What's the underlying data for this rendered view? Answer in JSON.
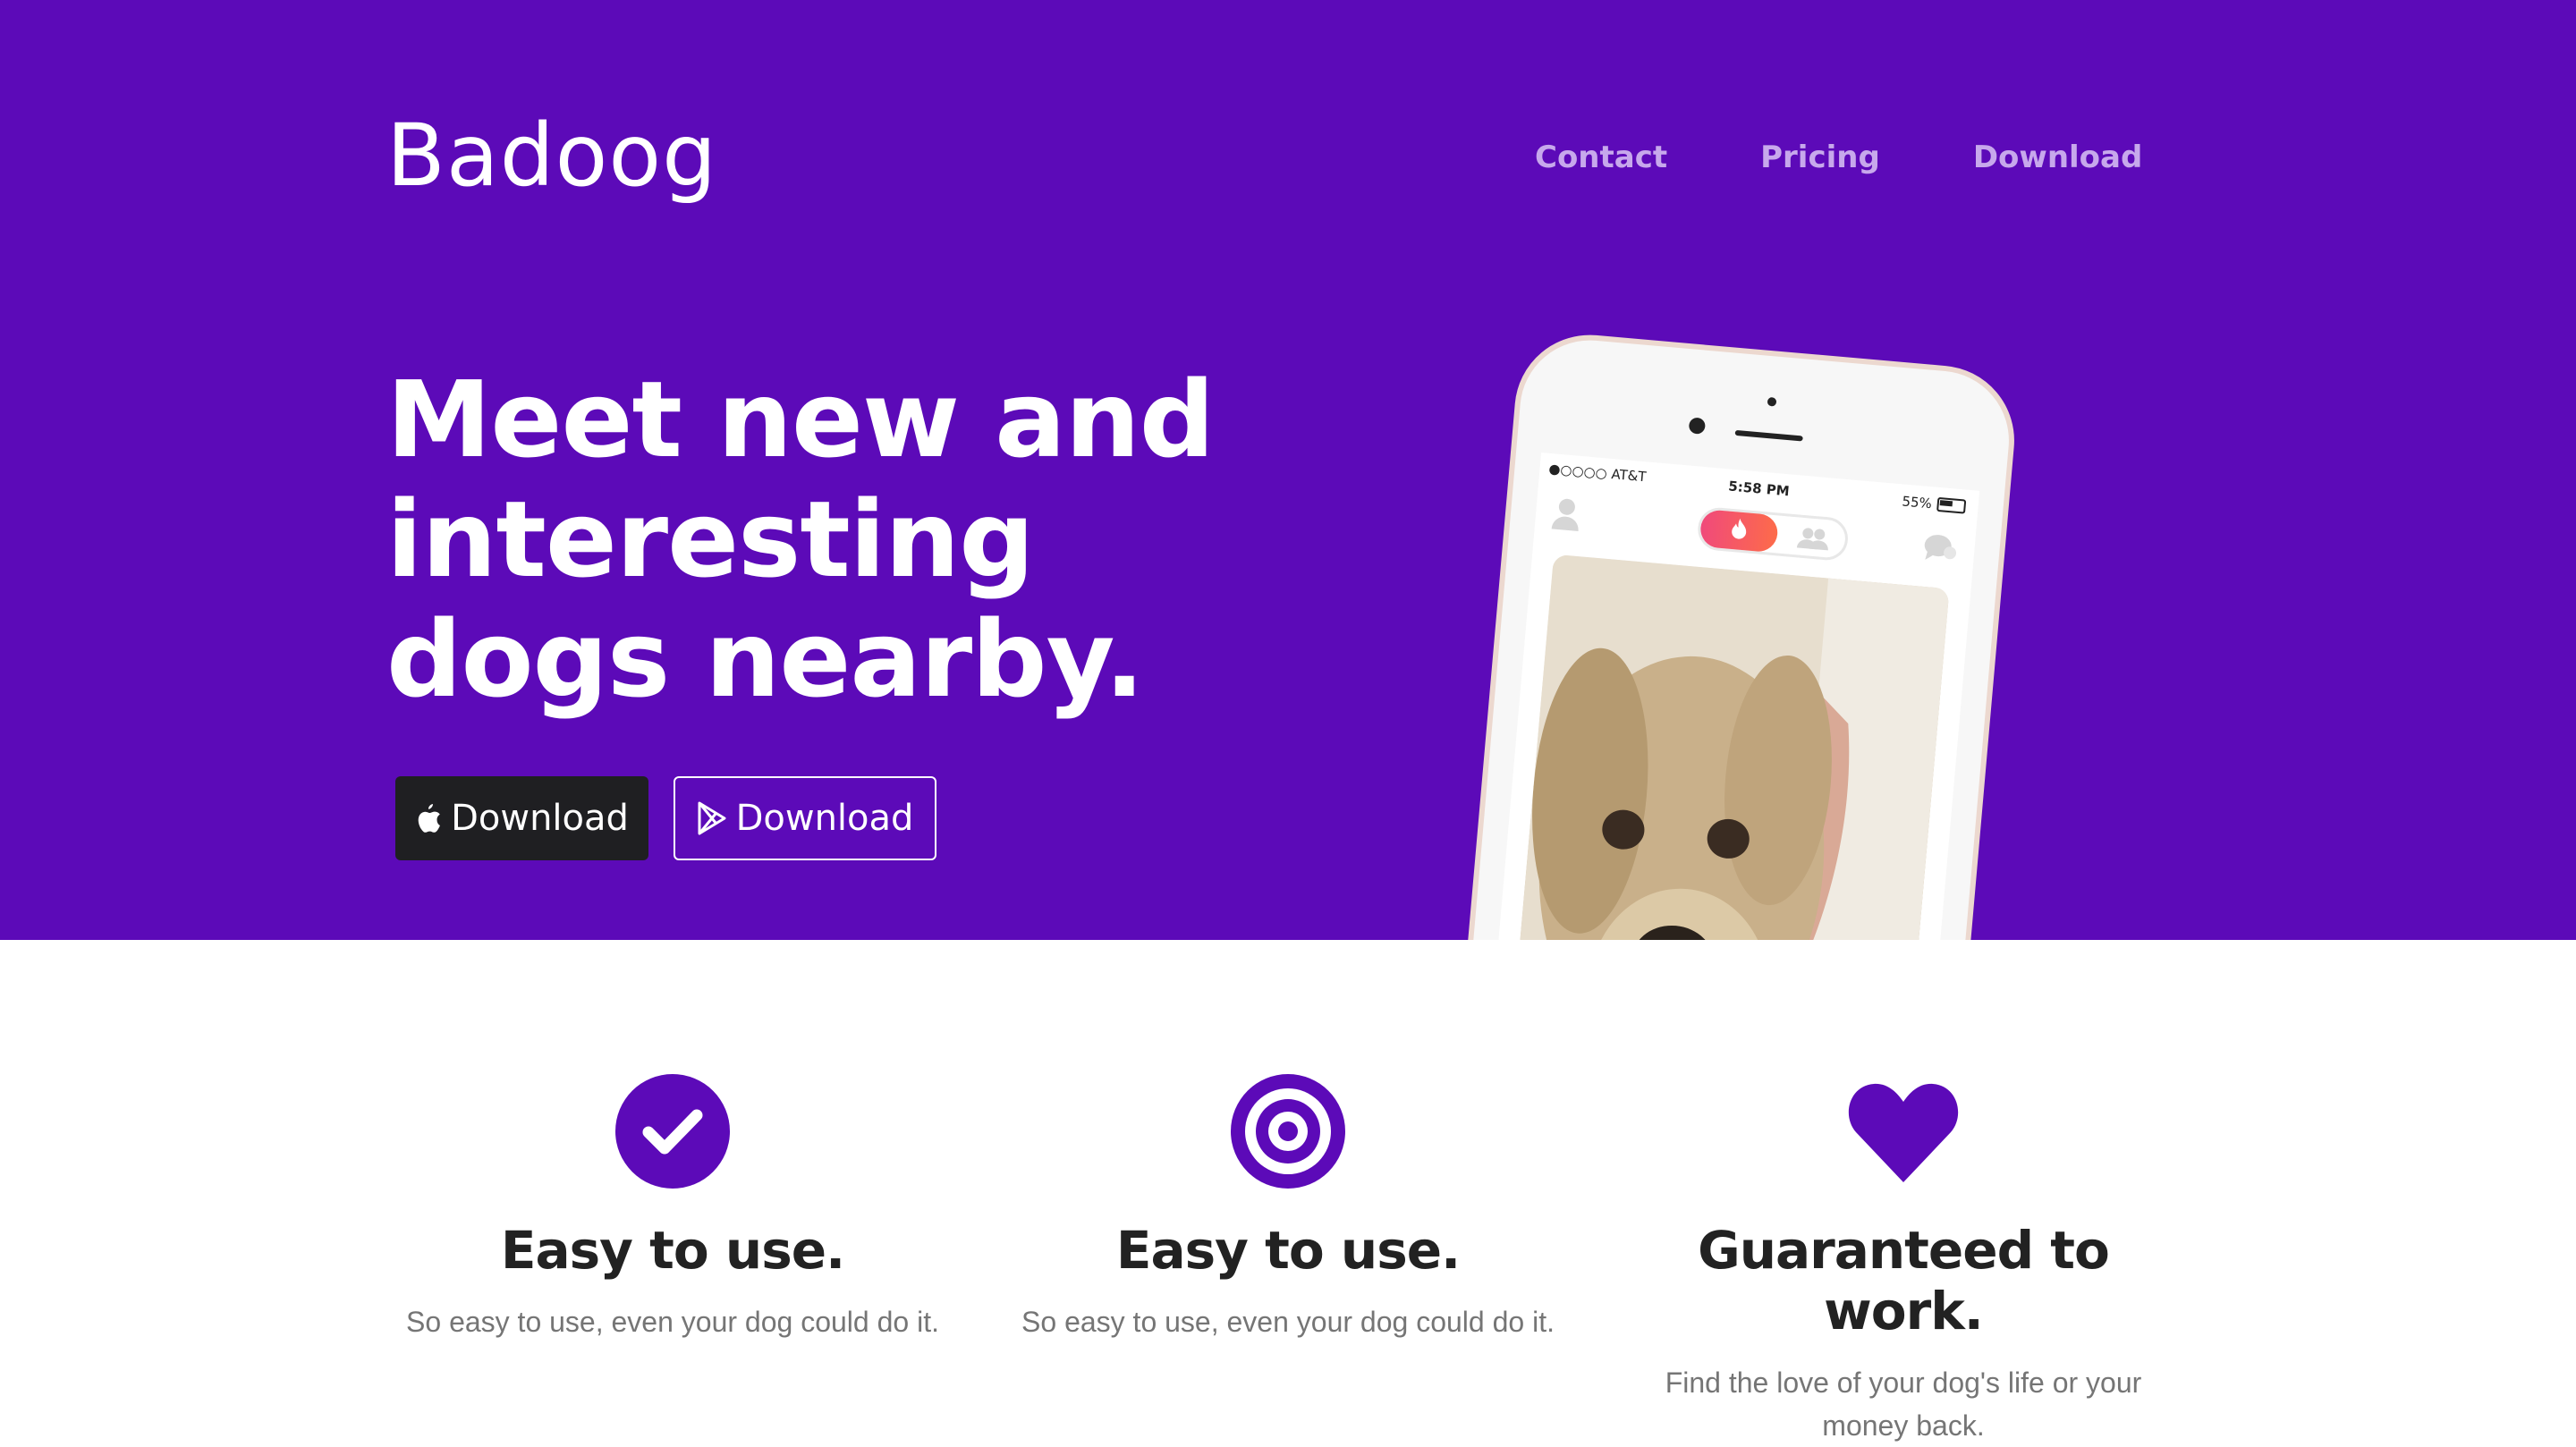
{
  "brand": "Badoog",
  "nav": [
    "Contact",
    "Pricing",
    "Download"
  ],
  "hero": {
    "headline": "Meet new and interesting dogs nearby.",
    "apple_button_label": "Download",
    "play_button_label": "Download"
  },
  "phone": {
    "carrier": "●○○○○ AT&T",
    "time": "5:58 PM",
    "battery": "55%"
  },
  "features": [
    {
      "icon": "check-circle-icon",
      "title": "Easy to use.",
      "text": "So easy to use, even your dog could do it."
    },
    {
      "icon": "target-icon",
      "title": "Easy to use.",
      "text": "So easy to use, even your dog could do it."
    },
    {
      "icon": "heart-icon",
      "title": "Guaranteed to work.",
      "text": "Find the love of your dog's life or your money back."
    }
  ],
  "colors": {
    "accent": "#5c0ab8",
    "nav_link": "#c7a8ec",
    "dark_button": "#1f1f22"
  }
}
